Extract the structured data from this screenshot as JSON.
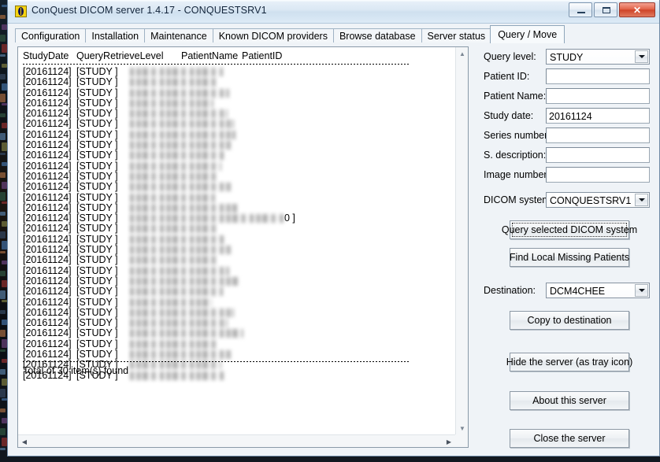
{
  "window": {
    "title": "ConQuest DICOM server 1.4.17 - CONQUESTSRV1",
    "icon": "conquest-app-icon",
    "buttons": {
      "minimize": "minimize-icon",
      "maximize": "maximize-icon",
      "close": "✕"
    }
  },
  "tabs": [
    {
      "label": "Configuration",
      "active": false
    },
    {
      "label": "Installation",
      "active": false
    },
    {
      "label": "Maintenance",
      "active": false
    },
    {
      "label": "Known DICOM providers",
      "active": false
    },
    {
      "label": "Browse database",
      "active": false
    },
    {
      "label": "Server status",
      "active": false
    },
    {
      "label": "Query / Move",
      "active": true
    }
  ],
  "list": {
    "columns": [
      "StudyDate",
      "QueryRetrieveLevel",
      "PatientName",
      "PatientID"
    ],
    "rows": [
      {
        "date": "[20161124]",
        "level": "[STUDY ]",
        "redacted": true,
        "redact_width": 118,
        "tail": ""
      },
      {
        "date": "[20161124]",
        "level": "[STUDY ]",
        "redacted": true,
        "redact_width": 112,
        "tail": ""
      },
      {
        "date": "[20161124]",
        "level": "[STUDY ]",
        "redacted": true,
        "redact_width": 126,
        "tail": ""
      },
      {
        "date": "[20161124]",
        "level": "[STUDY ]",
        "redacted": true,
        "redact_width": 106,
        "tail": ""
      },
      {
        "date": "[20161124]",
        "level": "[STUDY ]",
        "redacted": true,
        "redact_width": 124,
        "tail": ""
      },
      {
        "date": "[20161124]",
        "level": "[STUDY ]",
        "redacted": true,
        "redact_width": 132,
        "tail": ""
      },
      {
        "date": "[20161124]",
        "level": "[STUDY ]",
        "redacted": true,
        "redact_width": 134,
        "tail": ""
      },
      {
        "date": "[20161124]",
        "level": "[STUDY ]",
        "redacted": true,
        "redact_width": 130,
        "tail": ""
      },
      {
        "date": "[20161124]",
        "level": "[STUDY ]",
        "redacted": true,
        "redact_width": 122,
        "tail": ""
      },
      {
        "date": "[20161124]",
        "level": "[STUDY ]",
        "redacted": true,
        "redact_width": 116,
        "tail": ""
      },
      {
        "date": "[20161124]",
        "level": "[STUDY ]",
        "redacted": true,
        "redact_width": 112,
        "tail": ""
      },
      {
        "date": "[20161124]",
        "level": "[STUDY ]",
        "redacted": true,
        "redact_width": 128,
        "tail": ""
      },
      {
        "date": "[20161124]",
        "level": "[STUDY ]",
        "redacted": true,
        "redact_width": 108,
        "tail": ""
      },
      {
        "date": "[20161124]",
        "level": "[STUDY ]",
        "redacted": true,
        "redact_width": 136,
        "tail": ""
      },
      {
        "date": "[20161124]",
        "level": "[STUDY ]",
        "redacted": true,
        "redact_width": 196,
        "tail": "0 ]"
      },
      {
        "date": "[20161124]",
        "level": "[STUDY ]",
        "redacted": true,
        "redact_width": 110,
        "tail": ""
      },
      {
        "date": "[20161124]",
        "level": "[STUDY ]",
        "redacted": true,
        "redact_width": 120,
        "tail": ""
      },
      {
        "date": "[20161124]",
        "level": "[STUDY ]",
        "redacted": true,
        "redact_width": 130,
        "tail": ""
      },
      {
        "date": "[20161124]",
        "level": "[STUDY ]",
        "redacted": true,
        "redact_width": 114,
        "tail": ""
      },
      {
        "date": "[20161124]",
        "level": "[STUDY ]",
        "redacted": true,
        "redact_width": 126,
        "tail": ""
      },
      {
        "date": "[20161124]",
        "level": "[STUDY ]",
        "redacted": true,
        "redact_width": 140,
        "tail": ""
      },
      {
        "date": "[20161124]",
        "level": "[STUDY ]",
        "redacted": true,
        "redact_width": 118,
        "tail": ""
      },
      {
        "date": "[20161124]",
        "level": "[STUDY ]",
        "redacted": true,
        "redact_width": 104,
        "tail": ""
      },
      {
        "date": "[20161124]",
        "level": "[STUDY ]",
        "redacted": true,
        "redact_width": 132,
        "tail": ""
      },
      {
        "date": "[20161124]",
        "level": "[STUDY ]",
        "redacted": true,
        "redact_width": 124,
        "tail": ""
      },
      {
        "date": "[20161124]",
        "level": "[STUDY ]",
        "redacted": true,
        "redact_width": 144,
        "tail": ""
      },
      {
        "date": "[20161124]",
        "level": "[STUDY ]",
        "redacted": true,
        "redact_width": 112,
        "tail": ""
      },
      {
        "date": "[20161124]",
        "level": "[STUDY ]",
        "redacted": true,
        "redact_width": 128,
        "tail": ""
      },
      {
        "date": "[20161124]",
        "level": "[STUDY ]",
        "redacted": true,
        "redact_width": 116,
        "tail": ""
      },
      {
        "date": "[20161124]",
        "level": "[STUDY ]",
        "redacted": true,
        "redact_width": 120,
        "tail": ""
      }
    ],
    "status": "Total of 30 item(s) found",
    "scrollbars": {
      "vertical_up": "▲",
      "vertical_down": "▼",
      "horizontal_left": "◀",
      "horizontal_right": "▶"
    }
  },
  "panel": {
    "fields": [
      {
        "label": "Query level:",
        "type": "combo",
        "value": "STUDY",
        "placeholder": ""
      },
      {
        "label": "Patient ID:",
        "type": "text",
        "value": "",
        "placeholder": ""
      },
      {
        "label": "Patient Name:",
        "type": "text",
        "value": "",
        "placeholder": ""
      },
      {
        "label": "Study date:",
        "type": "text",
        "value": "20161124",
        "placeholder": ""
      },
      {
        "label": "Series number:",
        "type": "text",
        "value": "",
        "placeholder": ""
      },
      {
        "label": "S. description:",
        "type": "text",
        "value": "",
        "placeholder": ""
      },
      {
        "label": "Image number:",
        "type": "text",
        "value": "",
        "placeholder": ""
      },
      {
        "label": "DICOM system:",
        "type": "combo",
        "value": "CONQUESTSRV1",
        "placeholder": ""
      }
    ],
    "destination": {
      "label": "Destination:",
      "value": "DCM4CHEE"
    },
    "buttons": [
      {
        "label": "Query selected DICOM system",
        "focused": true
      },
      {
        "label": "Find Local Missing Patients",
        "focused": false
      },
      {
        "label": "Copy to destination",
        "focused": false
      },
      {
        "label": "Hide the server (as tray icon)",
        "focused": false
      },
      {
        "label": "About this server",
        "focused": false
      },
      {
        "label": "Close the server",
        "focused": false
      }
    ]
  },
  "colors": {
    "window_bg": "#eff3f7",
    "titlebar": "#dbe8f4",
    "close_button": "#cf4429",
    "accent_icon": "#f5d312",
    "list_bg": "#ffffff",
    "border": "#8a9aa8"
  }
}
